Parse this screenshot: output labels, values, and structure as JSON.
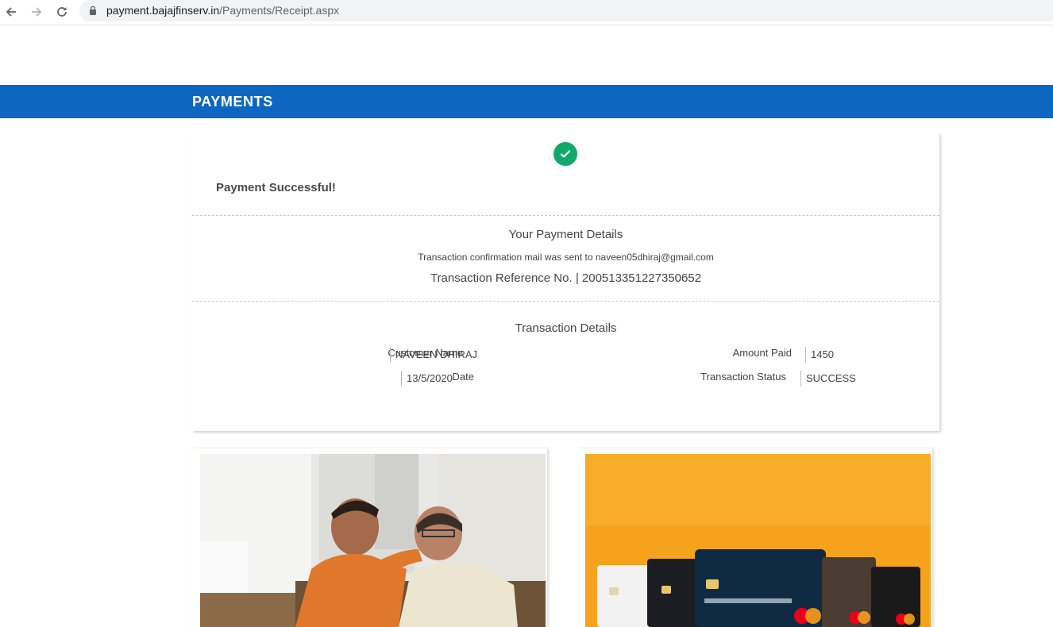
{
  "browser": {
    "url_host": "payment.bajajfinserv.in",
    "url_path": "/Payments/Receipt.aspx",
    "icons": [
      "back-arrow-icon",
      "forward-arrow-icon",
      "reload-icon",
      "lock-icon"
    ]
  },
  "header": {
    "title": "PAYMENTS",
    "color": "#0d67c1"
  },
  "receipt": {
    "status_message": "Payment Successful!",
    "status_icon": "check-circle-icon",
    "status_color": "#11a86b",
    "payment_details": {
      "title": "Your Payment Details",
      "mail_note": "Transaction confirmation mail was sent to naveen05dhiraj@gmail.com",
      "reference": "Transaction Reference No. | 200513351227350652"
    },
    "transaction_details": {
      "title": "Transaction Details",
      "customer_name_label": "Customer Name",
      "customer_name_value": "NAVEEN DHIRAJ",
      "amount_label": "Amount Paid",
      "amount_value": "1450",
      "date_label": "Date",
      "date_value": "13/5/2020",
      "status_label": "Transaction Status",
      "status_value": "SUCCESS"
    }
  },
  "promos": {
    "left_image": "father-son-photo",
    "right_image": "credit-cards-on-orange-banner"
  }
}
